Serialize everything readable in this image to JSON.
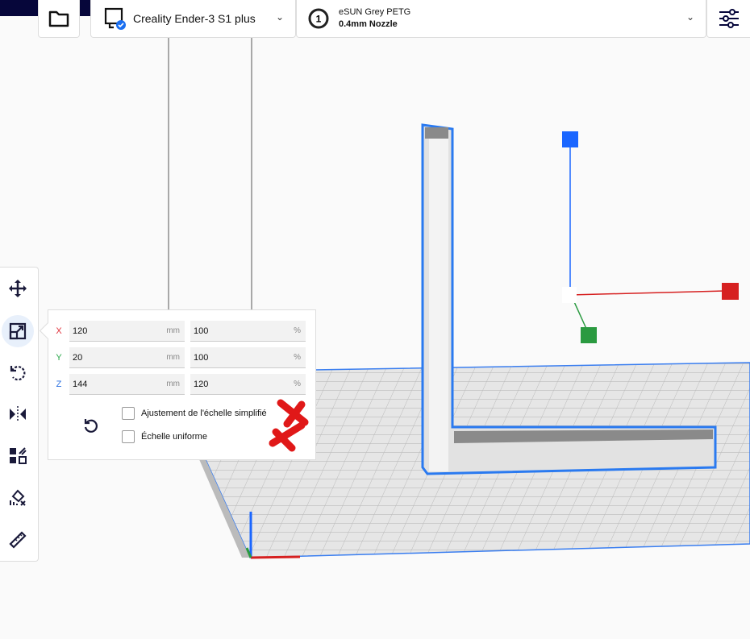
{
  "header": {
    "printer_name": "Creality Ender-3 S1 plus",
    "material_name": "eSUN Grey PETG",
    "nozzle": "0.4mm Nozzle",
    "extruder_number": "1"
  },
  "toolbar": {
    "tools": [
      "move",
      "scale",
      "rotate",
      "mirror",
      "per-model-settings",
      "support-blocker",
      "measure"
    ],
    "active": "scale"
  },
  "scale_panel": {
    "rows": [
      {
        "axis": "X",
        "mm": "120",
        "mm_unit": "mm",
        "percent": "100",
        "percent_unit": "%",
        "color": "#e0303a"
      },
      {
        "axis": "Y",
        "mm": "20",
        "mm_unit": "mm",
        "percent": "100",
        "percent_unit": "%",
        "color": "#2aa84a"
      },
      {
        "axis": "Z",
        "mm": "144",
        "mm_unit": "mm",
        "percent": "120",
        "percent_unit": "%",
        "color": "#2a6fe0"
      }
    ],
    "snap_scaling_label": "Ajustement de l'échelle simplifié",
    "snap_scaling_checked": false,
    "uniform_scaling_label": "Échelle uniforme",
    "uniform_scaling_checked": false
  },
  "colors": {
    "accent": "#196ef0",
    "selection": "#2a7af0"
  }
}
